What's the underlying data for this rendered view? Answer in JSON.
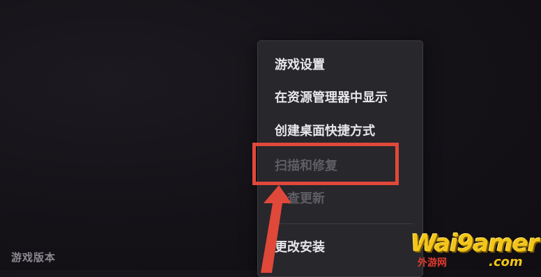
{
  "footer": {
    "version_label": "游戏版本"
  },
  "context_menu": {
    "items": [
      {
        "label": "游戏设置",
        "state": "enabled"
      },
      {
        "label": "在资源管理器中显示",
        "state": "enabled"
      },
      {
        "label": "创建桌面快捷方式",
        "state": "enabled"
      },
      {
        "label": "扫描和修复",
        "state": "disabled"
      },
      {
        "label": "检查更新",
        "state": "disabled"
      },
      {
        "label": "更改安装",
        "state": "enabled"
      }
    ]
  },
  "annotation": {
    "highlight_color": "#e0483a"
  },
  "watermark": {
    "brand": "Wai9amer",
    "sub_cn": "外游网",
    "sub_domain": ".com"
  },
  "colors": {
    "background": "#141217",
    "menu_background": "#28272c",
    "menu_text": "#e8e8ec",
    "menu_text_disabled": "#5f5e64",
    "watermark_gold": "#f2c518"
  }
}
